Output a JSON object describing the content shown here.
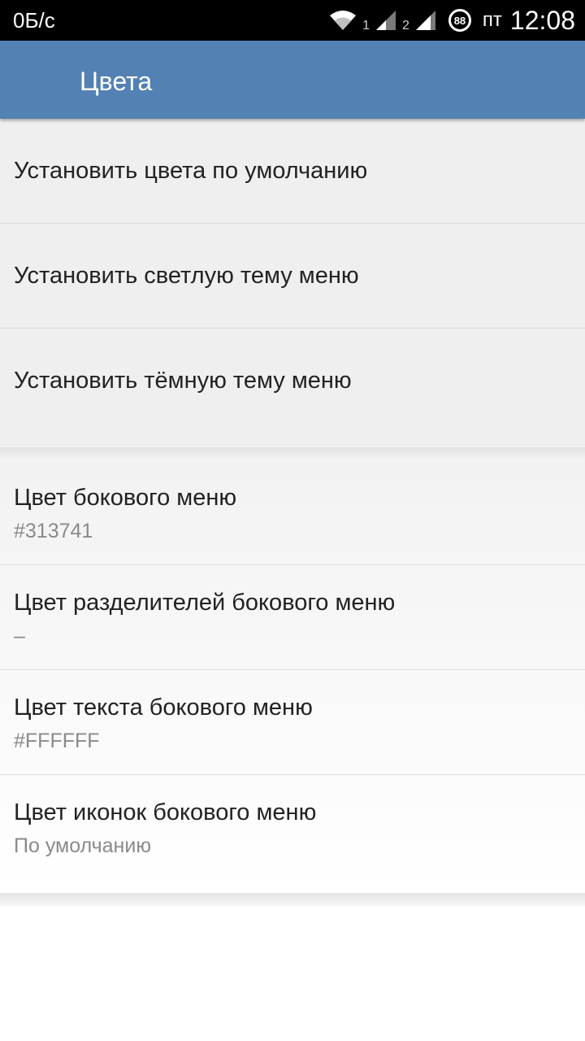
{
  "status_bar": {
    "speed": "0Б/с",
    "sim1": "1",
    "sim2": "2",
    "battery": "88",
    "day": "пт",
    "time": "12:08"
  },
  "app_bar": {
    "title": "Цвета",
    "color": "#5381b4"
  },
  "theme_actions": [
    {
      "title": "Установить цвета по умолчанию"
    },
    {
      "title": "Установить светлую тему меню"
    },
    {
      "title": "Установить тёмную тему меню"
    }
  ],
  "color_settings": [
    {
      "title": "Цвет бокового меню",
      "summary": "#313741"
    },
    {
      "title": "Цвет разделителей бокового меню",
      "summary": "–"
    },
    {
      "title": "Цвет текста бокового меню",
      "summary": "#FFFFFF"
    },
    {
      "title": "Цвет иконок бокового меню",
      "summary": "По умолчанию"
    }
  ]
}
